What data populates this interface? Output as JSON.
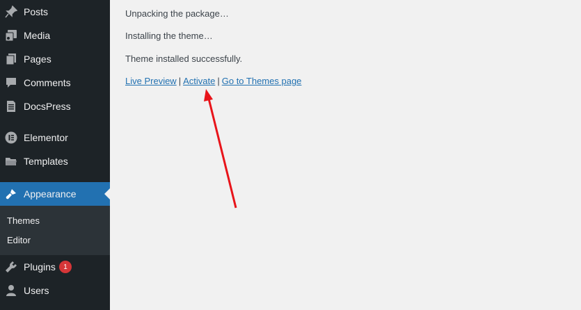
{
  "sidebar": {
    "items": [
      {
        "label": "Posts",
        "icon": "pin-icon"
      },
      {
        "label": "Media",
        "icon": "media-icon"
      },
      {
        "label": "Pages",
        "icon": "pages-icon"
      },
      {
        "label": "Comments",
        "icon": "comment-icon"
      },
      {
        "label": "DocsPress",
        "icon": "document-icon"
      },
      {
        "label": "Elementor",
        "icon": "elementor-icon"
      },
      {
        "label": "Templates",
        "icon": "folder-icon"
      },
      {
        "label": "Appearance",
        "icon": "brush-icon",
        "active": true
      },
      {
        "label": "Plugins",
        "icon": "plugin-icon",
        "badge": "1"
      },
      {
        "label": "Users",
        "icon": "user-icon"
      }
    ],
    "submenu": [
      {
        "label": "Themes"
      },
      {
        "label": "Editor"
      }
    ]
  },
  "main": {
    "messages": [
      "Unpacking the package…",
      "Installing the theme…",
      "Theme installed successfully."
    ],
    "links": {
      "live_preview": "Live Preview",
      "activate": "Activate",
      "themes_page": "Go to Themes page",
      "separator": "|"
    }
  },
  "colors": {
    "sidebar_bg": "#1d2327",
    "submenu_bg": "#2c3338",
    "accent": "#2271b1",
    "badge": "#d63638",
    "annotation_arrow": "#e8141a",
    "page_bg": "#f1f1f1"
  }
}
